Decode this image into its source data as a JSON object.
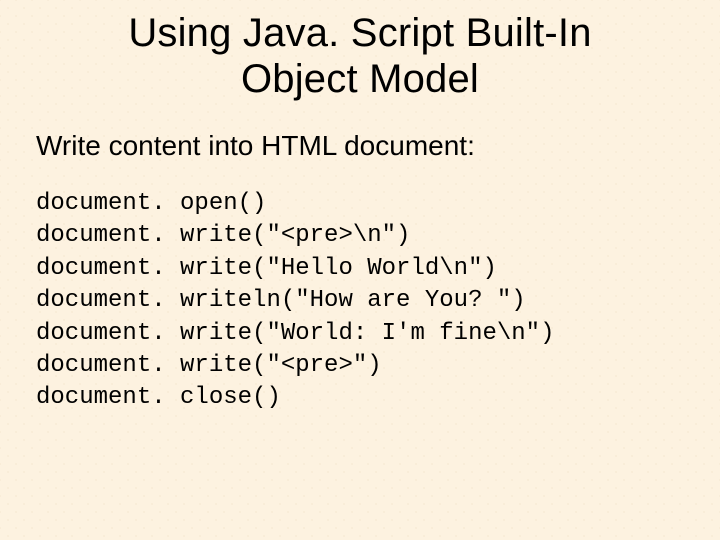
{
  "title_line1": "Using Java. Script Built-In",
  "title_line2": "Object Model",
  "subtitle": "Write content into HTML document:",
  "code": [
    "document. open()",
    "document. write(\"<pre>\\n\")",
    "document. write(\"Hello World\\n\")",
    "document. writeln(\"How are You? \")",
    "document. write(\"World: I'm fine\\n\")",
    "document. write(\"<pre>\")",
    "document. close()"
  ]
}
